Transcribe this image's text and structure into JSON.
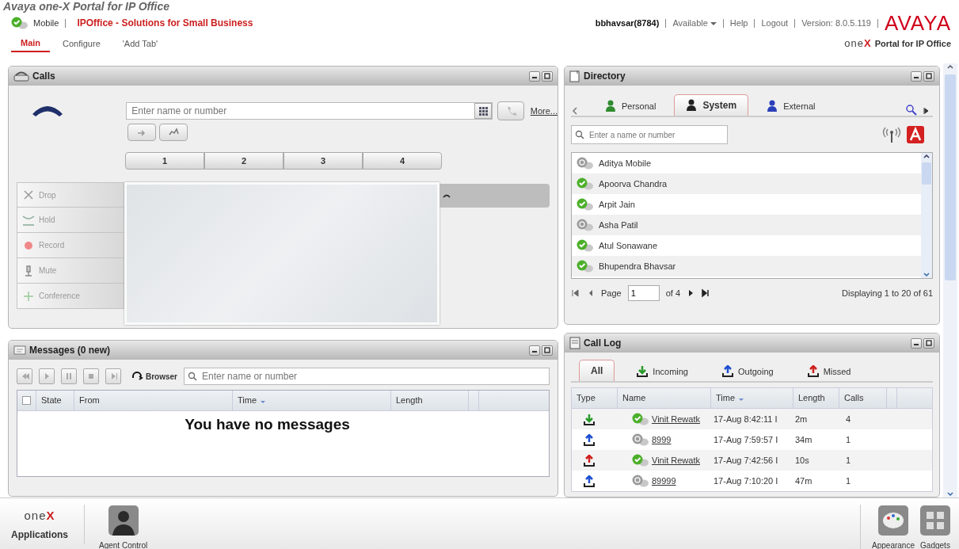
{
  "window": {
    "title": "Avaya one-X Portal for IP Office"
  },
  "header": {
    "available": true,
    "mobile_label": "Mobile",
    "site_title": "IPOffice - Solutions for Small Business",
    "user": "bbhavsar(8784)",
    "availability": "Available",
    "links": [
      "Help",
      "Logout"
    ],
    "version": "Version: 8.0.5.119",
    "brand": "AVAYA",
    "product_logo": "one",
    "product_logo_mark": "X",
    "product_name": "Portal for IP Office"
  },
  "tabs": [
    {
      "label": "Main",
      "selected": true
    },
    {
      "label": "Configure",
      "selected": false
    },
    {
      "label": "'Add Tab'",
      "selected": false
    }
  ],
  "calls": {
    "title": "Calls",
    "dial_placeholder": "Enter name or number",
    "more_link": "More...",
    "lines": [
      {
        "label": "1"
      },
      {
        "label": "2"
      },
      {
        "label": "3"
      },
      {
        "label": "4"
      }
    ],
    "actions": [
      {
        "label": "Drop",
        "kind": "drop",
        "disabled": true
      },
      {
        "label": "Hold",
        "kind": "hold",
        "disabled": true
      },
      {
        "label": "Record",
        "kind": "record",
        "disabled": true
      },
      {
        "label": "Mute",
        "kind": "mute",
        "disabled": true
      },
      {
        "label": "Conference",
        "kind": "conference",
        "disabled": true
      }
    ]
  },
  "messages": {
    "title": "Messages (0 new)",
    "browser_label": "Browser",
    "search_placeholder": "Enter name or number",
    "columns": [
      {
        "label": "State",
        "sorted": false
      },
      {
        "label": "From",
        "sorted": false
      },
      {
        "label": "Time",
        "sorted": true
      },
      {
        "label": "Length",
        "sorted": false
      }
    ],
    "select_all_checked": false,
    "empty_text": "You have no messages"
  },
  "directory": {
    "title": "Directory",
    "tabs": [
      {
        "label": "Personal",
        "kind": "personal",
        "selected": false
      },
      {
        "label": "System",
        "kind": "system",
        "selected": true
      },
      {
        "label": "External",
        "kind": "external",
        "selected": false
      }
    ],
    "search_placeholder": "Enter a name or number",
    "contacts": [
      {
        "name": "Aditya Mobile",
        "available": false
      },
      {
        "name": "Apoorva Chandra",
        "available": true
      },
      {
        "name": "Arpit Jain",
        "available": true
      },
      {
        "name": "Asha Patil",
        "available": false
      },
      {
        "name": "Atul Sonawane",
        "available": true
      },
      {
        "name": "Bhupendra Bhavsar",
        "available": true
      }
    ],
    "pager": {
      "page_label": "Page",
      "page": "1",
      "of_label": "of 4",
      "summary": "Displaying 1 to 20 of 61"
    }
  },
  "call_log": {
    "title": "Call Log",
    "tabs": [
      {
        "label": "All",
        "kind": "all",
        "selected": true
      },
      {
        "label": "Incoming",
        "kind": "incoming",
        "selected": false
      },
      {
        "label": "Outgoing",
        "kind": "outgoing",
        "selected": false
      },
      {
        "label": "Missed",
        "kind": "missed",
        "selected": false
      }
    ],
    "columns": [
      {
        "label": "Type",
        "sorted": false
      },
      {
        "label": "Name",
        "sorted": false
      },
      {
        "label": "Time",
        "sorted": true
      },
      {
        "label": "Length",
        "sorted": false
      },
      {
        "label": "Calls",
        "sorted": false
      }
    ],
    "rows": [
      {
        "kind": "incoming",
        "available": true,
        "name": "Vinit Rewatk",
        "time": "17-Aug 8:42:11 I",
        "length": "2m",
        "calls": "4"
      },
      {
        "kind": "outgoing",
        "available": false,
        "name": "8999",
        "time": "17-Aug 7:59:57 I",
        "length": "34m",
        "calls": "1"
      },
      {
        "kind": "missed",
        "available": true,
        "name": "Vinit Rewatk",
        "time": "17-Aug 7:42:56 I",
        "length": "10s",
        "calls": "1"
      },
      {
        "kind": "outgoing",
        "available": false,
        "name": "89999",
        "time": "17-Aug 7:10:20 I",
        "length": "47m",
        "calls": "1"
      }
    ]
  },
  "bottom_bar": {
    "logo": "one",
    "logo_mark": "X",
    "launcher_label": "Applications",
    "apps": [
      {
        "label": "Agent Control",
        "kind": "agent"
      }
    ],
    "tools": [
      {
        "label": "Appearance",
        "kind": "appearance"
      },
      {
        "label": "Gadgets",
        "kind": "gadgets"
      }
    ]
  }
}
